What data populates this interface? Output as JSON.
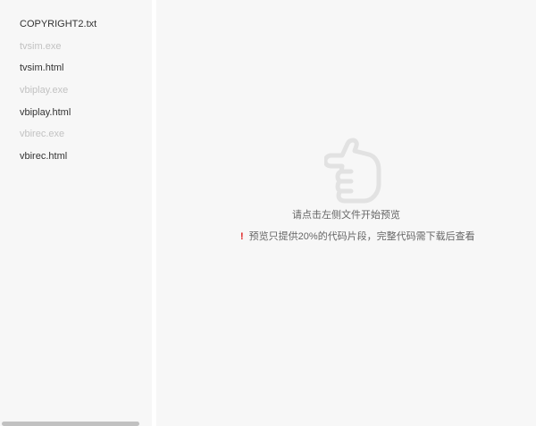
{
  "sidebar": {
    "files": [
      {
        "name": "COPYRIGHT2.txt",
        "enabled": true
      },
      {
        "name": "tvsim.exe",
        "enabled": false
      },
      {
        "name": "tvsim.html",
        "enabled": true
      },
      {
        "name": "vbiplay.exe",
        "enabled": false
      },
      {
        "name": "vbiplay.html",
        "enabled": true
      },
      {
        "name": "vbirec.exe",
        "enabled": false
      },
      {
        "name": "vbirec.html",
        "enabled": true
      }
    ]
  },
  "main": {
    "icon": "pointing-hand-left-icon",
    "hint": "请点击左侧文件开始预览",
    "note_icon": "!",
    "note": "预览只提供20%的代码片段，完整代码需下载后查看"
  },
  "colors": {
    "panel_background": "#f7f7f7",
    "file_text": "#333333",
    "file_text_disabled": "#c2c2c2",
    "hint_text": "#666666",
    "warning_icon": "#e02020"
  }
}
